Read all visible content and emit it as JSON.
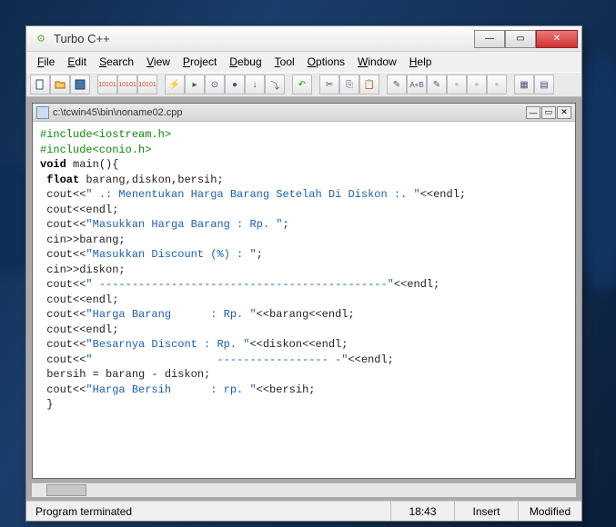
{
  "app": {
    "title": "Turbo C++"
  },
  "menu": {
    "file": "File",
    "edit": "Edit",
    "search": "Search",
    "view": "View",
    "project": "Project",
    "debug": "Debug",
    "tool": "Tool",
    "options": "Options",
    "window": "Window",
    "help": "Help"
  },
  "editor": {
    "path": "c:\\tcwin45\\bin\\noname02.cpp"
  },
  "code": {
    "l1": "#include<iostream.h>",
    "l2": "#include<conio.h>",
    "l3a": "void",
    "l3b": " main(){",
    "l4a": " float",
    "l4b": " barang,diskon,bersih;",
    "l5a": " cout<<",
    "l5b": "\" .: Menentukan Harga Barang Setelah Di Diskon :. \"",
    "l5c": "<<endl;",
    "l6": " cout<<endl;",
    "l7a": " cout<<",
    "l7b": "\"Masukkan Harga Barang : Rp. \"",
    "l7c": ";",
    "l8": " cin>>barang;",
    "l9a": " cout<<",
    "l9b": "\"Masukkan Discount (%) : \"",
    "l9c": ";",
    "l10": " cin>>diskon;",
    "l11a": " cout<<",
    "l11b": "\" --------------------------------------------\"",
    "l11c": "<<endl;",
    "l12": " cout<<endl;",
    "l13a": " cout<<",
    "l13b": "\"Harga Barang      : Rp. \"",
    "l13c": "<<barang<<endl;",
    "l14": " cout<<endl;",
    "l15a": " cout<<",
    "l15b": "\"Besarnya Discont : Rp. \"",
    "l15c": "<<diskon<<endl;",
    "l16a": " cout<<",
    "l16b": "\"                   ----------------- -\"",
    "l16c": "<<endl;",
    "l17": " bersih = barang - diskon;",
    "l18a": " cout<<",
    "l18b": "\"Harga Bersih      : rp. \"",
    "l18c": "<<bersih;",
    "l19": " }"
  },
  "status": {
    "msg": "Program terminated",
    "pos": "18:43",
    "mode": "Insert",
    "state": "Modified"
  }
}
